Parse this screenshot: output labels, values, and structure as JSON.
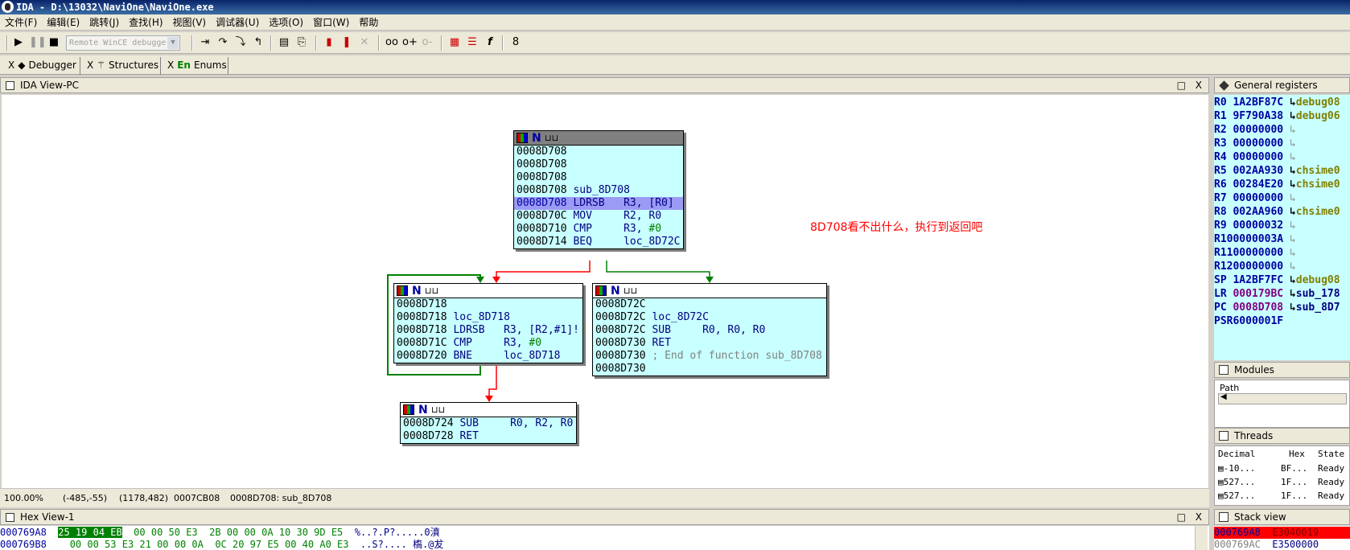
{
  "window": {
    "title": "IDA - D:\\13032\\NaviOne\\NaviOne.exe"
  },
  "menu": [
    "文件(F)",
    "编辑(E)",
    "跳转(J)",
    "查找(H)",
    "视图(V)",
    "调试器(U)",
    "选项(O)",
    "窗口(W)",
    "帮助"
  ],
  "toolbar": {
    "debugger_select": "Remote WinCE debugger"
  },
  "tabs": [
    {
      "label": "Debugger",
      "icon": "debugger-icon"
    },
    {
      "label": "Structures",
      "icon": "structures-icon"
    },
    {
      "label": "Enums",
      "icon_text": "En"
    }
  ],
  "main_view": {
    "title": "IDA View-PC",
    "controls": "□ X"
  },
  "graph": {
    "annotation": "8D708看不出什么，执行到返回吧",
    "nodes": [
      {
        "id": "node1",
        "lines": [
          {
            "addr": "0008D708",
            "text": ""
          },
          {
            "addr": "0008D708",
            "text": ""
          },
          {
            "addr": "0008D708",
            "text": ""
          },
          {
            "addr": "0008D708",
            "text": " sub_8D708"
          },
          {
            "addr": "0008D708",
            "text": " LDRSB   R3, [R0]",
            "highlight": true
          },
          {
            "addr": "0008D70C",
            "text": " MOV     R2, R0"
          },
          {
            "addr": "0008D710",
            "text": " CMP     R3, ",
            "imm": "#0"
          },
          {
            "addr": "0008D714",
            "text": " BEQ     loc_8D72C"
          }
        ]
      },
      {
        "id": "node2",
        "lines": [
          {
            "addr": "0008D718",
            "text": ""
          },
          {
            "addr": "0008D718",
            "text": " loc_8D718"
          },
          {
            "addr": "0008D718",
            "text": " LDRSB   R3, [R2,#1]!"
          },
          {
            "addr": "0008D71C",
            "text": " CMP     R3, ",
            "imm": "#0"
          },
          {
            "addr": "0008D720",
            "text": " BNE     loc_8D718"
          }
        ]
      },
      {
        "id": "node3",
        "lines": [
          {
            "addr": "0008D72C",
            "text": ""
          },
          {
            "addr": "0008D72C",
            "text": " loc_8D72C"
          },
          {
            "addr": "0008D72C",
            "text": " SUB     R0, R0, R0"
          },
          {
            "addr": "0008D730",
            "text": " RET"
          },
          {
            "addr": "0008D730",
            "text": " ",
            "comment": "; End of function sub_8D708"
          },
          {
            "addr": "0008D730",
            "text": ""
          }
        ]
      },
      {
        "id": "node4",
        "lines": [
          {
            "addr": "0008D724",
            "text": " SUB     R0, R2, R0"
          },
          {
            "addr": "0008D728",
            "text": " RET"
          }
        ]
      }
    ]
  },
  "status": {
    "zoom": "100.00%",
    "coords": "(-485,-55)",
    "pos": "(1178,482)",
    "offset": "0007CB08",
    "location": "0008D708: sub_8D708"
  },
  "hex_view": {
    "title": "Hex View-1",
    "rows": [
      {
        "addr": "000769A8",
        "sel": "25 19 04 EB",
        "bytes": "  00 00 50 E3  2B 00 00 0A 10 30 9D E5",
        "text": "  %..?.P?.....0濆"
      },
      {
        "addr": "000769B8",
        "sel": "",
        "bytes": "  00 00 53 E3 21 00 00 0A  0C 20 97 E5 00 40 A0 E3",
        "text": "  ..S?.... 槗.@犮"
      }
    ]
  },
  "registers": {
    "title": "General registers",
    "rows": [
      {
        "name": "R0",
        "value": " 1A2BF87C",
        "arrow": "↳",
        "ref": "debug08",
        "changed": false
      },
      {
        "name": "R1",
        "value": " 9F790A38",
        "arrow": "↳",
        "ref": "debug06",
        "changed": false
      },
      {
        "name": "R2",
        "value": " 00000000",
        "arrow": "↳",
        "ref": "",
        "changed": false
      },
      {
        "name": "R3",
        "value": " 00000000",
        "arrow": "↳",
        "ref": "",
        "changed": false
      },
      {
        "name": "R4",
        "value": " 00000000",
        "arrow": "↳",
        "ref": "",
        "changed": false
      },
      {
        "name": "R5",
        "value": " 002AA930",
        "arrow": "↳",
        "ref": "chsime0",
        "changed": false
      },
      {
        "name": "R6",
        "value": " 00284E20",
        "arrow": "↳",
        "ref": "chsime0",
        "changed": false
      },
      {
        "name": "R7",
        "value": " 00000000",
        "arrow": "↳",
        "ref": "",
        "changed": false
      },
      {
        "name": "R8",
        "value": " 002AA960",
        "arrow": "↳",
        "ref": "chsime0",
        "changed": false
      },
      {
        "name": "R9",
        "value": " 00000032",
        "arrow": "↳",
        "ref": "",
        "changed": false
      },
      {
        "name": "R10",
        "value": "0000003A",
        "arrow": "↳",
        "ref": "",
        "changed": false
      },
      {
        "name": "R11",
        "value": "00000000",
        "arrow": "↳",
        "ref": "",
        "changed": false
      },
      {
        "name": "R12",
        "value": "00000000",
        "arrow": "↳",
        "ref": "",
        "changed": false
      },
      {
        "name": "SP",
        "value": " 1A2BF7FC",
        "arrow": "↳",
        "ref": "debug08",
        "changed": false
      },
      {
        "name": "LR",
        "value": " 000179BC",
        "arrow": "↳",
        "ref": "sub_178",
        "changed": true
      },
      {
        "name": "PC",
        "value": " 0008D708",
        "arrow": "↳",
        "ref": "sub_8D7",
        "changed": true
      },
      {
        "name": "PSR",
        "value": "6000001F",
        "arrow": "",
        "ref": "",
        "changed": false
      }
    ]
  },
  "modules": {
    "title": "Modules",
    "column": "Path"
  },
  "threads": {
    "title": "Threads",
    "columns": [
      "Decimal",
      "Hex",
      "State"
    ],
    "rows": [
      {
        "decimal": "-10...",
        "hex": "BF...",
        "state": "Ready"
      },
      {
        "decimal": "527...",
        "hex": "1F...",
        "state": "Ready"
      },
      {
        "decimal": "527...",
        "hex": "1F...",
        "state": "Ready"
      }
    ]
  },
  "stack_view": {
    "title": "Stack view",
    "rows": [
      {
        "addr": "000769A8",
        "value": "E3040019",
        "current": true
      },
      {
        "addr": "000769AC",
        "value": "E3500000",
        "current": false
      }
    ]
  },
  "colors": {
    "node_bg": "#c8ffff",
    "highlight": "#9b9bf5",
    "true_edge": "#008000",
    "false_edge": "#ff0000"
  }
}
